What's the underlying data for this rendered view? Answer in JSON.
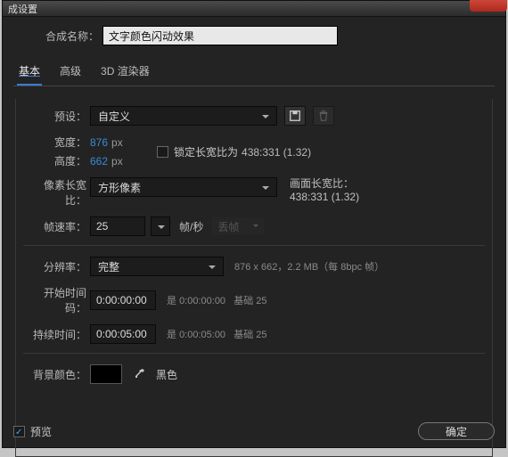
{
  "title": "成设置",
  "comp_name_label": "合成名称：",
  "comp_name_value": "文字颜色闪动效果",
  "tabs": {
    "basic": "基本",
    "advanced": "高级",
    "renderer": "3D 渲染器"
  },
  "preset": {
    "label": "预设：",
    "value": "自定义"
  },
  "width": {
    "label": "宽度：",
    "value": "876",
    "unit": "px"
  },
  "height": {
    "label": "高度：",
    "value": "662",
    "unit": "px"
  },
  "lock_aspect": {
    "label": "锁定长宽比为",
    "ratio": "438:331 (1.32)"
  },
  "par": {
    "label": "像素长宽比：",
    "value": "方形像素"
  },
  "frame_aspect": {
    "label": "画面长宽比：",
    "value": "438:331 (1.32)"
  },
  "fps": {
    "label": "帧速率：",
    "value": "25",
    "unit": "帧/秒",
    "drop": "丢帧"
  },
  "resolution": {
    "label": "分辨率：",
    "value": "完整",
    "note_dim": "876 x 662",
    "note_size": "，2.2 MB（每 8bpc 帧）"
  },
  "start": {
    "label": "开始时间码：",
    "value": "0:00:00:00",
    "is": "是",
    "is_val": "0:00:00:00",
    "base": "基础 25"
  },
  "duration": {
    "label": "持续时间：",
    "value": "0:00:05:00",
    "is": "是",
    "is_val": "0:00:05:00",
    "base": "基础 25"
  },
  "bg": {
    "label": "背景颜色：",
    "name": "黑色"
  },
  "preview": "预览",
  "ok": "确定"
}
